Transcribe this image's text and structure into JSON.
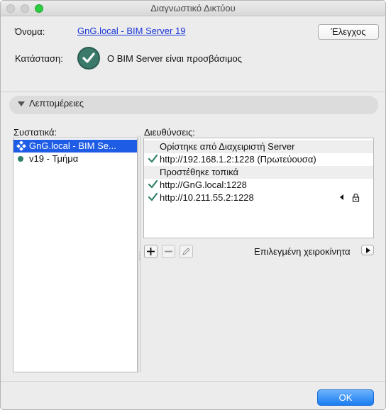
{
  "window": {
    "title": "Διαγνωστικό Δικτύου"
  },
  "name_row": {
    "label": "Όνομα:",
    "value": "GnG.local - BIM Server 19",
    "check_button": "Έλεγχος"
  },
  "status_row": {
    "label": "Κατάσταση:",
    "text": "Ο BIM Server είναι προσβάσιμος",
    "icon": "check-circle-icon"
  },
  "details": {
    "label": "Λεπτομέρειες"
  },
  "components": {
    "label": "Συστατικά:",
    "items": [
      {
        "label": "GnG.local - BIM Se...",
        "icon": "server-cluster-icon",
        "selected": true
      },
      {
        "label": "v19 - Τμήμα",
        "icon": "green-dot-icon",
        "selected": false
      }
    ]
  },
  "addresses": {
    "label": "Διευθύνσεις:",
    "groups": [
      {
        "title": "Ορίστηκε από Διαχειριστή Server",
        "items": [
          "http://192.168.1.2:1228 (Πρωτεύουσα)"
        ]
      },
      {
        "title": "Προστέθηκε τοπικά",
        "items": [
          "http://GnG.local:1228",
          "http://10.211.55.2:1228"
        ]
      }
    ],
    "selected_manual": "Επιλεγμένη χειροκίνητα",
    "colors": {
      "check": "#2f7f6a"
    }
  },
  "footer": {
    "ok_label": "OK"
  }
}
